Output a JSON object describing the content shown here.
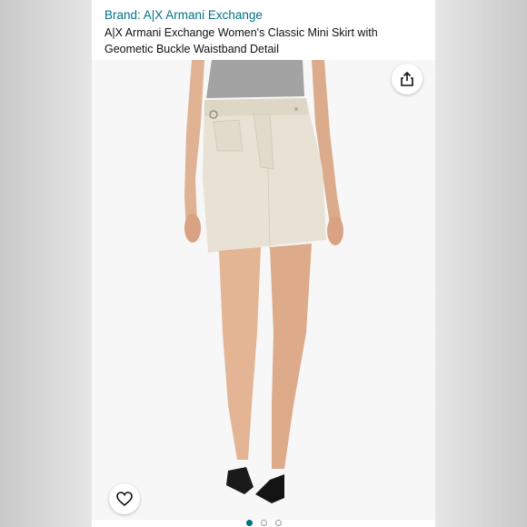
{
  "product": {
    "brand_link": "Brand: A|X Armani Exchange",
    "title": "A|X Armani Exchange Women's Classic Mini Skirt with Geometic Buckle Waistband Detail"
  },
  "gallery": {
    "image_subject": "model wearing beige mini skirt",
    "image_count": 3,
    "active_index": 0
  },
  "icons": {
    "share": "share-icon",
    "favorite": "heart-icon"
  },
  "colors": {
    "brand_link": "#007185",
    "skirt": "#e8e2d4",
    "top": "#a3a3a3"
  }
}
